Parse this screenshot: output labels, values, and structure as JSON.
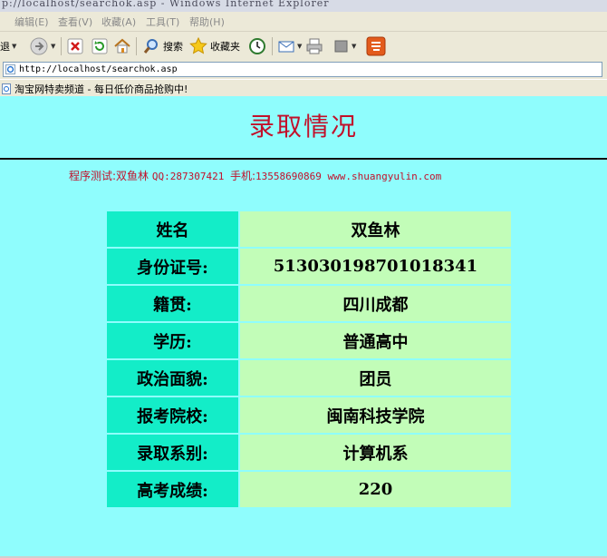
{
  "window": {
    "title": "p://localhost/searchok.asp - Windows Internet Explorer"
  },
  "menu": {
    "items": [
      "编辑(E)",
      "查看(V)",
      "收藏(A)",
      "工具(T)",
      "帮助(H)"
    ]
  },
  "toolbar": {
    "back_label": "退",
    "search_label": "搜索",
    "favorites_label": "收藏夹"
  },
  "address": {
    "url": "http://localhost/searchok.asp"
  },
  "links": {
    "item": "淘宝网特卖频道 - 每日低价商品抢购中!"
  },
  "page": {
    "title": "录取情况",
    "credit_prefix": "程序测试:双鱼林 ",
    "credit_contact": "QQ:287307421 ",
    "credit_phone_label": "手机:",
    "credit_phone": "13558690869 www.shuangyulin.com",
    "rows": [
      {
        "label": "姓名",
        "value": "双鱼林"
      },
      {
        "label": "身份证号:",
        "value": "513030198701018341"
      },
      {
        "label": "籍贯:",
        "value": "四川成都"
      },
      {
        "label": "学历:",
        "value": "普通高中"
      },
      {
        "label": "政治面貌:",
        "value": "团员"
      },
      {
        "label": "报考院校:",
        "value": "闽南科技学院"
      },
      {
        "label": "录取系别:",
        "value": "计算机系"
      },
      {
        "label": "高考成绩:",
        "value": "220"
      }
    ]
  },
  "colors": {
    "page_background": "#8ffdfd",
    "label_cell": "#13edc8",
    "value_cell": "#c2fdb8",
    "title_red": "#c2102a"
  }
}
